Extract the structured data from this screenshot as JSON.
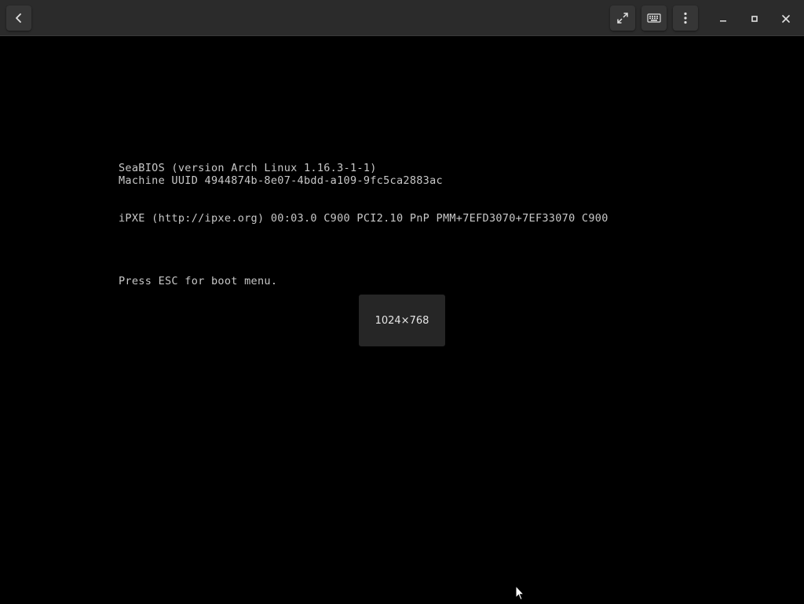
{
  "toolbar": {
    "back_icon": "chevron-left-icon",
    "fullscreen_icon": "expand-arrows-icon",
    "keyboard_icon": "keyboard-icon",
    "menu_icon": "vertical-dots-icon"
  },
  "window_controls": {
    "minimize_icon": "minimize-icon",
    "maximize_icon": "maximize-icon",
    "close_icon": "close-icon"
  },
  "console": {
    "lines": [
      "SeaBIOS (version Arch Linux 1.16.3-1-1)",
      "Machine UUID 4944874b-8e07-4bdd-a109-9fc5ca2883ac",
      "iPXE (http://ipxe.org) 00:03.0 C900 PCI2.10 PnP PMM+7EFD3070+7EF33070 C900",
      "Press ESC for boot menu."
    ]
  },
  "overlay": {
    "resolution": "1024×768"
  },
  "colors": {
    "titlebar": "#2b2b2b",
    "screen_bg": "#000000",
    "console_text": "#c8c8c8",
    "overlay_bg": "#262626"
  }
}
